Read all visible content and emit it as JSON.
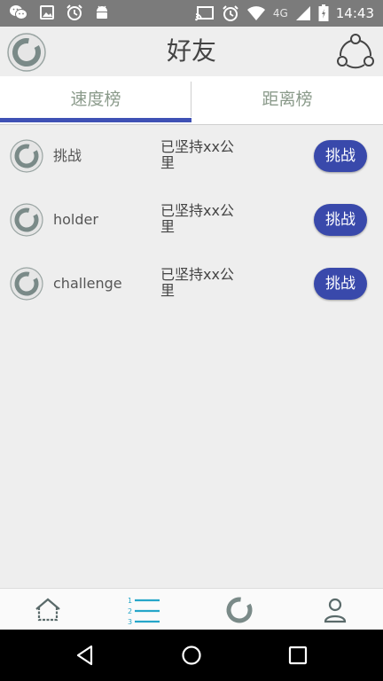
{
  "status_bar": {
    "time": "14:43",
    "network": "4G"
  },
  "header": {
    "title": "好友"
  },
  "tabs": [
    {
      "label": "速度榜",
      "active": true
    },
    {
      "label": "距离榜",
      "active": false
    }
  ],
  "friends": [
    {
      "name": "挑战",
      "status": "已坚持xx公里",
      "button": "挑战"
    },
    {
      "name": "holder",
      "status": "已坚持xx公里",
      "button": "挑战"
    },
    {
      "name": "challenge",
      "status": "已坚持xx公里",
      "button": "挑战"
    }
  ],
  "colors": {
    "accent": "#3f51b5",
    "button": "#3949ab",
    "nav_active": "#26a6c9",
    "icon_gray": "#7a8a88"
  }
}
